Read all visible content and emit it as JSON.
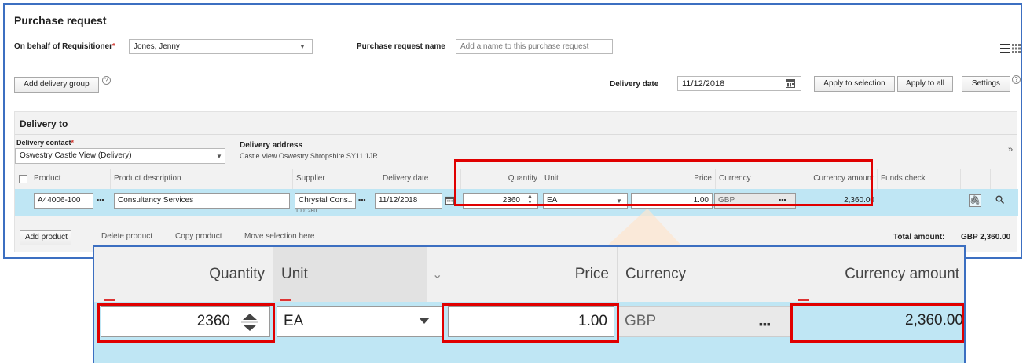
{
  "header": {
    "title": "Purchase request",
    "requisitioner_label": "On behalf of Requisitioner",
    "requisitioner_value": "Jones, Jenny",
    "pr_name_label": "Purchase request name",
    "pr_name_placeholder": "Add a name to this purchase request",
    "add_delivery_group": "Add delivery group",
    "delivery_date_label": "Delivery date",
    "delivery_date_value": "11/12/2018",
    "apply_to_selection": "Apply to selection",
    "apply_to_all": "Apply to all",
    "settings": "Settings"
  },
  "delivery": {
    "section_title": "Delivery to",
    "contact_label": "Delivery contact",
    "contact_value": "Oswestry Castle View (Delivery)",
    "address_label": "Delivery address",
    "address_value": "Castle View Oswestry Shropshire SY11 1JR"
  },
  "table": {
    "columns": [
      "Product",
      "Product description",
      "Supplier",
      "Delivery date",
      "Quantity",
      "Unit",
      "Price",
      "Currency",
      "Currency amount",
      "Funds check"
    ],
    "row": {
      "product": "A44006-100",
      "description": "Consultancy Services",
      "supplier": "Chrystal Cons..",
      "supplier_code": "1001280",
      "delivery_date": "11/12/2018",
      "quantity": "2360",
      "unit": "EA",
      "price": "1.00",
      "currency": "GBP",
      "currency_amount": "2,360.00"
    }
  },
  "footer": {
    "add_product": "Add product",
    "delete_product": "Delete product",
    "copy_product": "Copy product",
    "move_selection": "Move selection here",
    "total_label": "Total amount:",
    "total_value": "GBP 2,360.00"
  },
  "zoom": {
    "quantity_label": "Quantity",
    "unit_label": "Unit",
    "price_label": "Price",
    "currency_label": "Currency",
    "currency_amount_label": "Currency amount",
    "quantity_value": "2360",
    "unit_value": "EA",
    "price_value": "1.00",
    "currency_value": "GBP",
    "currency_amount_value": "2,360.00"
  },
  "colors": {
    "highlight_red": "#e00000",
    "row_blue": "#bfe6f4",
    "frame_blue": "#3c6fc1"
  }
}
